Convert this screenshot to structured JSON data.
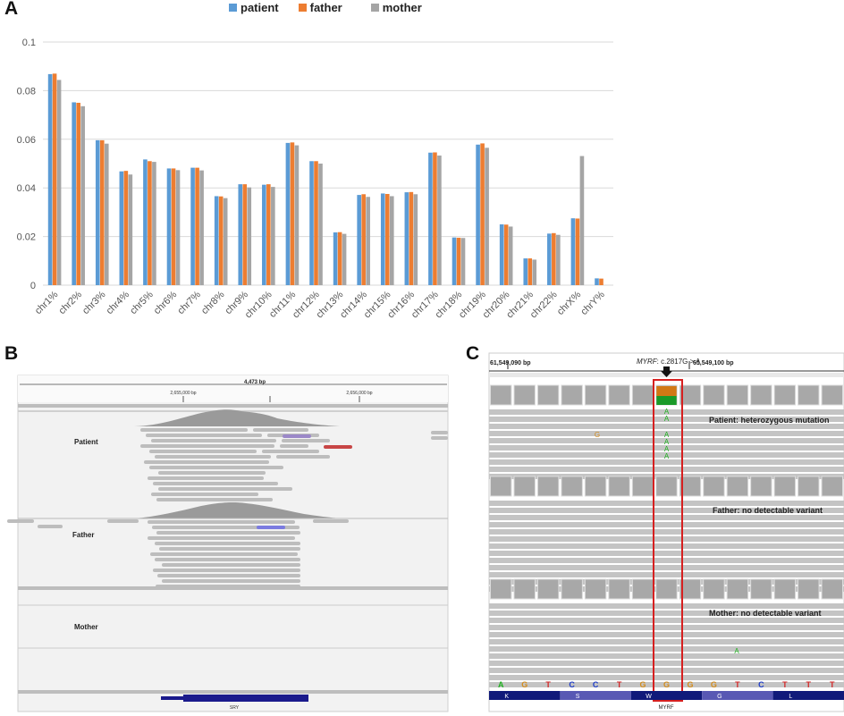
{
  "panels": {
    "a": "A",
    "b": "B",
    "c": "C"
  },
  "legend": [
    {
      "name": "patient",
      "color": "#5b9bd5"
    },
    {
      "name": "father",
      "color": "#ed7d31"
    },
    {
      "name": "mother",
      "color": "#a5a5a5"
    }
  ],
  "chart_data": {
    "type": "bar",
    "categories": [
      "chr1%",
      "chr2%",
      "chr3%",
      "chr4%",
      "chr5%",
      "chr6%",
      "chr7%",
      "chr8%",
      "chr9%",
      "chr10%",
      "chr11%",
      "chr12%",
      "chr13%",
      "chr14%",
      "chr15%",
      "chr16%",
      "chr17%",
      "chr18%",
      "chr19%",
      "chr20%",
      "chr21%",
      "chr22%",
      "chrX%",
      "chrY%"
    ],
    "series": [
      {
        "name": "patient",
        "color": "#5b9bd5",
        "values": [
          0.0868,
          0.0752,
          0.0596,
          0.0468,
          0.0517,
          0.048,
          0.0483,
          0.0366,
          0.0415,
          0.0413,
          0.0585,
          0.051,
          0.0217,
          0.0371,
          0.0377,
          0.0382,
          0.0545,
          0.0196,
          0.0578,
          0.025,
          0.011,
          0.0212,
          0.0275,
          0.0028
        ]
      },
      {
        "name": "father",
        "color": "#ed7d31",
        "values": [
          0.087,
          0.075,
          0.0596,
          0.047,
          0.051,
          0.048,
          0.0483,
          0.0365,
          0.0415,
          0.0415,
          0.0587,
          0.051,
          0.0218,
          0.0374,
          0.0375,
          0.0383,
          0.0546,
          0.0195,
          0.0583,
          0.0249,
          0.011,
          0.0214,
          0.0274,
          0.0027
        ]
      },
      {
        "name": "mother",
        "color": "#a5a5a5",
        "values": [
          0.0844,
          0.0736,
          0.0582,
          0.0455,
          0.0507,
          0.0473,
          0.0472,
          0.0358,
          0.0402,
          0.0404,
          0.0575,
          0.05,
          0.0211,
          0.0363,
          0.0366,
          0.0374,
          0.0533,
          0.0194,
          0.0565,
          0.0241,
          0.0105,
          0.0207,
          0.0531,
          0
        ]
      }
    ],
    "yticks": [
      "0",
      "0.02",
      "0.04",
      "0.06",
      "0.08",
      "0.1"
    ],
    "ylim": [
      0,
      0.1
    ],
    "grid": true,
    "legend_position": "top"
  },
  "panel_b": {
    "window_size": "4,473 bp",
    "coord_left": "2,655,000 bp",
    "coord_right": "2,656,000 bp",
    "tracks": [
      "Patient",
      "Father",
      "Mother"
    ],
    "gene": "SRY"
  },
  "panel_c": {
    "coord_left": "61,549,090 bp",
    "coord_right": "61,549,100 bp",
    "variant_gene": "MYRF",
    "variant_change": ": c.2817G > A",
    "patient_label": "Patient: heterozygous mutation",
    "father_label": "Father: no detectable variant",
    "mother_label": "Mother: no detectable variant",
    "sequence": [
      "A",
      "G",
      "T",
      "C",
      "C",
      "T",
      "G",
      "G",
      "G",
      "G",
      "T",
      "C",
      "T",
      "T",
      "T"
    ],
    "amino_acids": [
      "K",
      "S",
      "W",
      "G",
      "L"
    ],
    "gene": "MYRF",
    "alt_base": "A",
    "other_base": "G"
  },
  "colors": {
    "A": "#20b020",
    "C": "#1e3cc8",
    "G": "#d28c1e",
    "T": "#d22828"
  }
}
